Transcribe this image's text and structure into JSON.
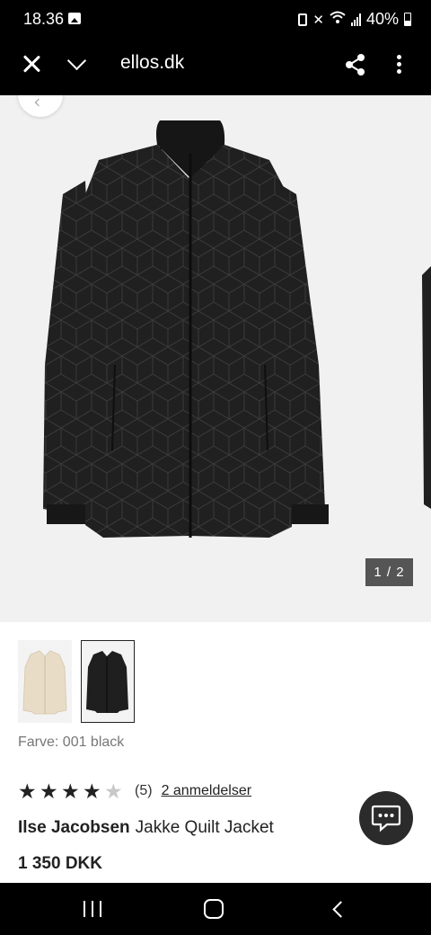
{
  "status_bar": {
    "time": "18.36",
    "battery": "40%",
    "icons": [
      "gallery-icon",
      "vibrate-icon",
      "mute-icon",
      "wifi-icon",
      "signal-icon",
      "battery-icon"
    ]
  },
  "browser": {
    "url": "ellos.dk",
    "icons": [
      "close-icon",
      "chevron-down-icon",
      "share-icon",
      "more-vert-icon"
    ]
  },
  "gallery": {
    "counter": "1 / 2",
    "background": "#f1f1f1"
  },
  "product": {
    "color_label": "Farve: 001 black",
    "rating": {
      "stars_filled": 4,
      "stars_total": 5,
      "count": "(5)",
      "reviews_link": "2 anmeldelser"
    },
    "brand": "Ilse Jacobsen",
    "name": "Jakke Quilt Jacket",
    "price": "1 350 DKK",
    "swatches": [
      {
        "name": "cream",
        "color": "#e9dcc7",
        "selected": false
      },
      {
        "name": "black",
        "color": "#1e1f1e",
        "selected": true
      }
    ]
  },
  "colors": {
    "jacket": "#1f201f",
    "star_filled": "#222222",
    "star_empty": "#c8c8c8"
  }
}
